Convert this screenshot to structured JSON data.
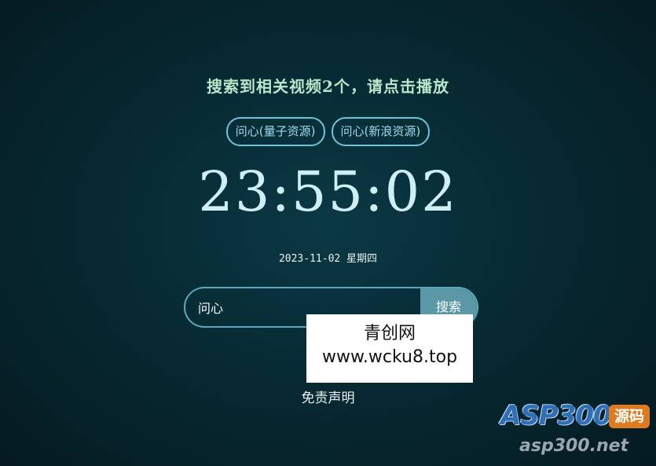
{
  "headline": "搜索到相关视频2个，请点击播放",
  "sources": [
    {
      "label": "问心(量子资源)"
    },
    {
      "label": "问心(新浪资源)"
    }
  ],
  "clock": {
    "time": "23:55:02"
  },
  "date": {
    "text": "2023-11-02 星期四"
  },
  "search": {
    "value": "问心",
    "button_label": "搜索"
  },
  "watermark": {
    "line1": "青创网",
    "line2": "www.wcku8.top"
  },
  "footer": {
    "disclaimer": "免责声明"
  },
  "logo": {
    "name": "ASP300",
    "badge": "源码",
    "url": "asp300.net"
  },
  "colors": {
    "background": "#072a33",
    "headline": "#b9e6c9",
    "source_border": "#6cc4d8",
    "search_button": "#5b98a6",
    "clock": "#cfeff6"
  }
}
